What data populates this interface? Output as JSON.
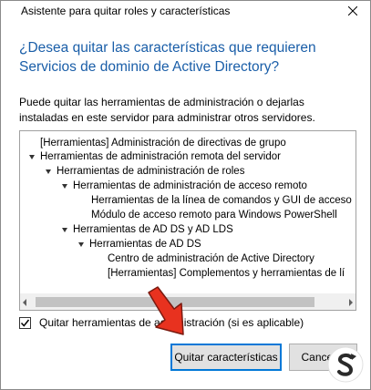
{
  "window": {
    "title": "Asistente para quitar roles y características"
  },
  "heading": "¿Desea quitar las características que requieren Servicios de dominio de Active Directory?",
  "description": "Puede quitar las herramientas de administración o dejarlas instaladas en este servidor para administrar otros servidores.",
  "tree": {
    "items": [
      {
        "label": "[Herramientas] Administración de directivas de grupo",
        "level": 0,
        "expanded": false
      },
      {
        "label": "Herramientas de administración remota del servidor",
        "level": 0,
        "expanded": true
      },
      {
        "label": "Herramientas de administración de roles",
        "level": 1,
        "expanded": true
      },
      {
        "label": "Herramientas de administración de acceso remoto",
        "level": 2,
        "expanded": true
      },
      {
        "label": "Herramientas de la línea de comandos y GUI de acceso",
        "level": 3,
        "expanded": false
      },
      {
        "label": "Módulo de acceso remoto para Windows PowerShell",
        "level": 3,
        "expanded": false
      },
      {
        "label": "Herramientas de AD DS y AD LDS",
        "level": 2,
        "expanded": true
      },
      {
        "label": "Herramientas de AD DS",
        "level": 3,
        "expanded": true
      },
      {
        "label": "Centro de administración de Active Directory",
        "level": 4,
        "expanded": false
      },
      {
        "label": "[Herramientas] Complementos y herramientas de lí",
        "level": 4,
        "expanded": false
      }
    ]
  },
  "checkbox": {
    "label": "Quitar herramientas de administración (si es aplicable)",
    "checked": true
  },
  "buttons": {
    "primary": "Quitar características",
    "cancel": "Cancelar"
  },
  "colors": {
    "heading": "#1a5ea8",
    "primary_border": "#0078d7",
    "arrow": "#e8321f"
  }
}
